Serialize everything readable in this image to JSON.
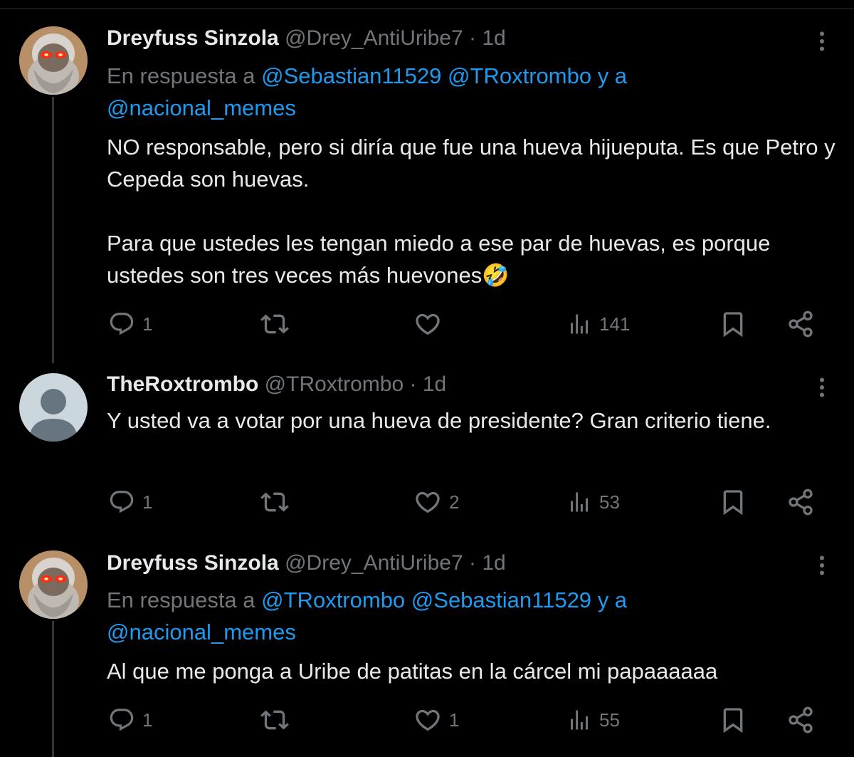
{
  "tweets": [
    {
      "display_name": "Dreyfuss Sinzola",
      "handle": "@Drey_AntiUribe7",
      "dot": "·",
      "time": "1d",
      "reply_prefix": "En respuesta a",
      "reply_mention_1": "@Sebastian11529",
      "reply_mention_2": "@TRoxtrombo",
      "reply_connector": "y a",
      "reply_mention_3": "@nacional_memes",
      "body": "NO responsable, pero si diría que fue una hueva hijueputa. Es que Petro y Cepeda son huevas.\n\nPara que ustedes les tengan miedo a ese par de huevas, es porque ustedes son tres veces más huevones🤣",
      "replies": "1",
      "reposts": "",
      "likes": "",
      "views": "141",
      "avatar": "marx-red-eyes-avatar"
    },
    {
      "display_name": "TheRoxtrombo",
      "handle": "@TRoxtrombo",
      "dot": "·",
      "time": "1d",
      "body": "Y usted va a votar por una hueva de presidente? Gran criterio tiene.",
      "replies": "1",
      "reposts": "",
      "likes": "2",
      "views": "53",
      "avatar": "default-person-avatar"
    },
    {
      "display_name": "Dreyfuss Sinzola",
      "handle": "@Drey_AntiUribe7",
      "dot": "·",
      "time": "1d",
      "reply_prefix": "En respuesta a",
      "reply_mention_1": "@TRoxtrombo",
      "reply_mention_2": "@Sebastian11529",
      "reply_connector": "y a",
      "reply_mention_3": "@nacional_memes",
      "body": "Al que me ponga a Uribe de patitas en la cárcel mi papaaaaaa",
      "replies": "1",
      "reposts": "",
      "likes": "1",
      "views": "55",
      "avatar": "marx-red-eyes-avatar"
    }
  ],
  "colors": {
    "background": "#000000",
    "text": "#e7e9ea",
    "muted": "#71767b",
    "link": "#1d9bf0",
    "thread_line": "#333639"
  }
}
